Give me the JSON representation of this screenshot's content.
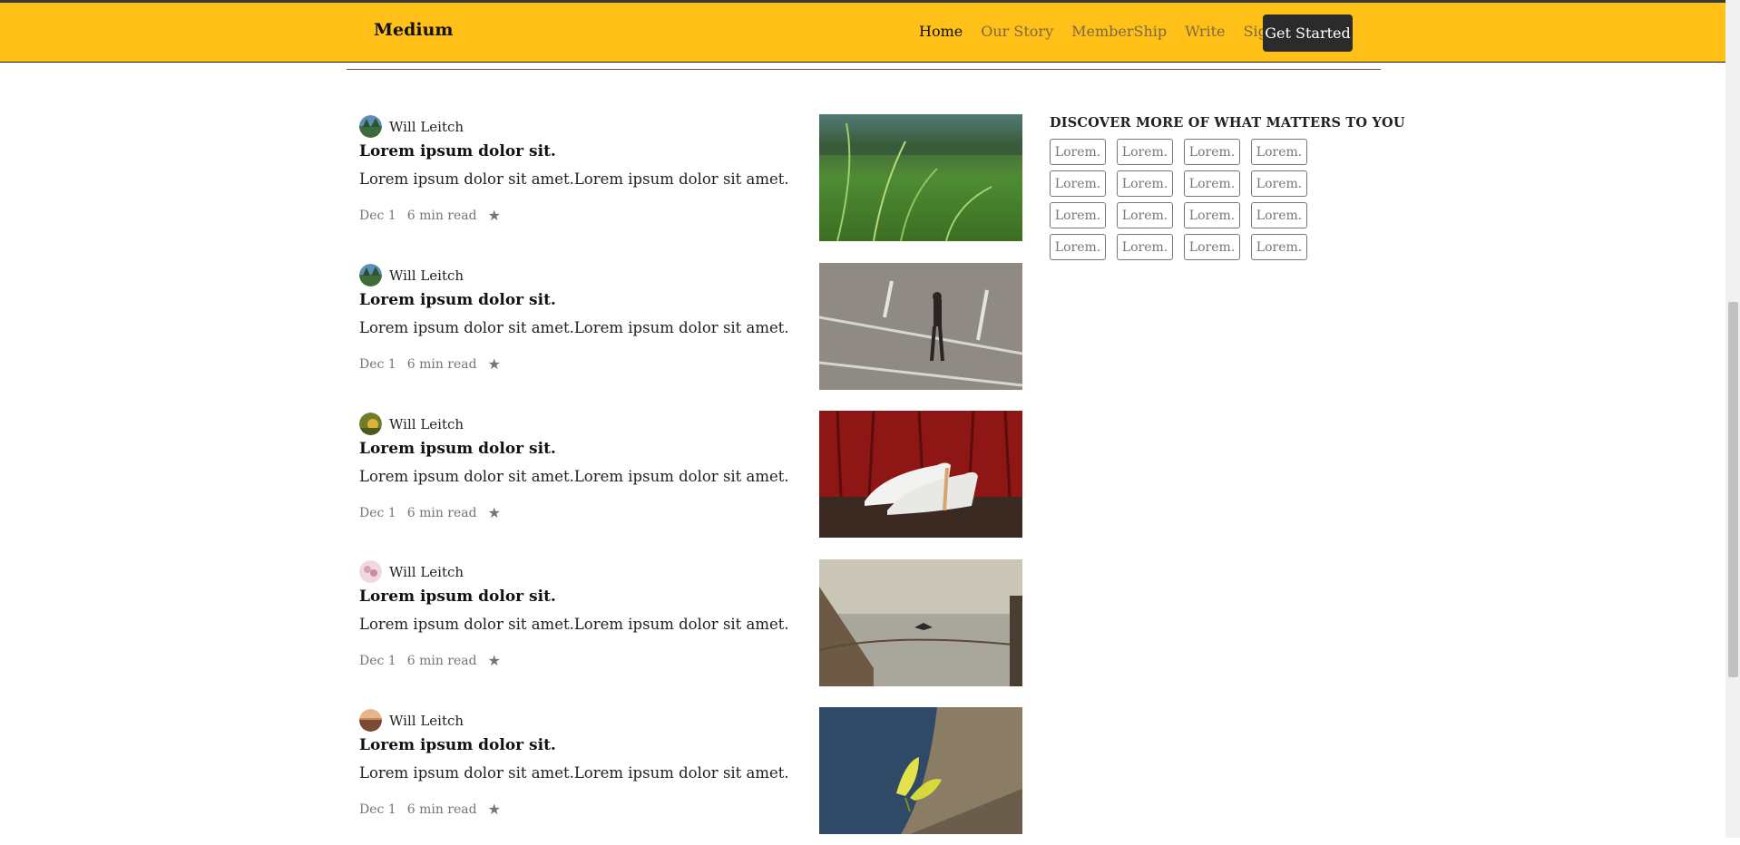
{
  "nav": {
    "brand": "Medium",
    "links": [
      "Home",
      "Our Story",
      "MemberShip",
      "Write",
      "Sign In"
    ],
    "cta": "Get Started"
  },
  "articles": [
    {
      "author": "Will Leitch",
      "title": "Lorem ipsum dolor sit.",
      "excerpt": "Lorem ipsum dolor sit amet.Lorem ipsum dolor sit amet.",
      "date": "Dec 1",
      "read_time": "6 min read",
      "star_icon": "star-icon"
    },
    {
      "author": "Will Leitch",
      "title": "Lorem ipsum dolor sit.",
      "excerpt": "Lorem ipsum dolor sit amet.Lorem ipsum dolor sit amet.",
      "date": "Dec 1",
      "read_time": "6 min read",
      "star_icon": "star-icon"
    },
    {
      "author": "Will Leitch",
      "title": "Lorem ipsum dolor sit.",
      "excerpt": "Lorem ipsum dolor sit amet.Lorem ipsum dolor sit amet.",
      "date": "Dec 1",
      "read_time": "6 min read",
      "star_icon": "star-icon"
    },
    {
      "author": "Will Leitch",
      "title": "Lorem ipsum dolor sit.",
      "excerpt": "Lorem ipsum dolor sit amet.Lorem ipsum dolor sit amet.",
      "date": "Dec 1",
      "read_time": "6 min read",
      "star_icon": "star-icon"
    },
    {
      "author": "Will Leitch",
      "title": "Lorem ipsum dolor sit.",
      "excerpt": "Lorem ipsum dolor sit amet.Lorem ipsum dolor sit amet.",
      "date": "Dec 1",
      "read_time": "6 min read",
      "star_icon": "star-icon"
    }
  ],
  "sidebar": {
    "title": "DISCOVER MORE OF WHAT MATTERS TO YOU",
    "tags": [
      "Lorem.",
      "Lorem.",
      "Lorem.",
      "Lorem.",
      "Lorem.",
      "Lorem.",
      "Lorem.",
      "Lorem.",
      "Lorem.",
      "Lorem.",
      "Lorem.",
      "Lorem.",
      "Lorem.",
      "Lorem.",
      "Lorem.",
      "Lorem."
    ]
  },
  "colors": {
    "navbar": "#ffc017",
    "cta_bg": "#2b2b2b",
    "muted_text": "#757575"
  }
}
